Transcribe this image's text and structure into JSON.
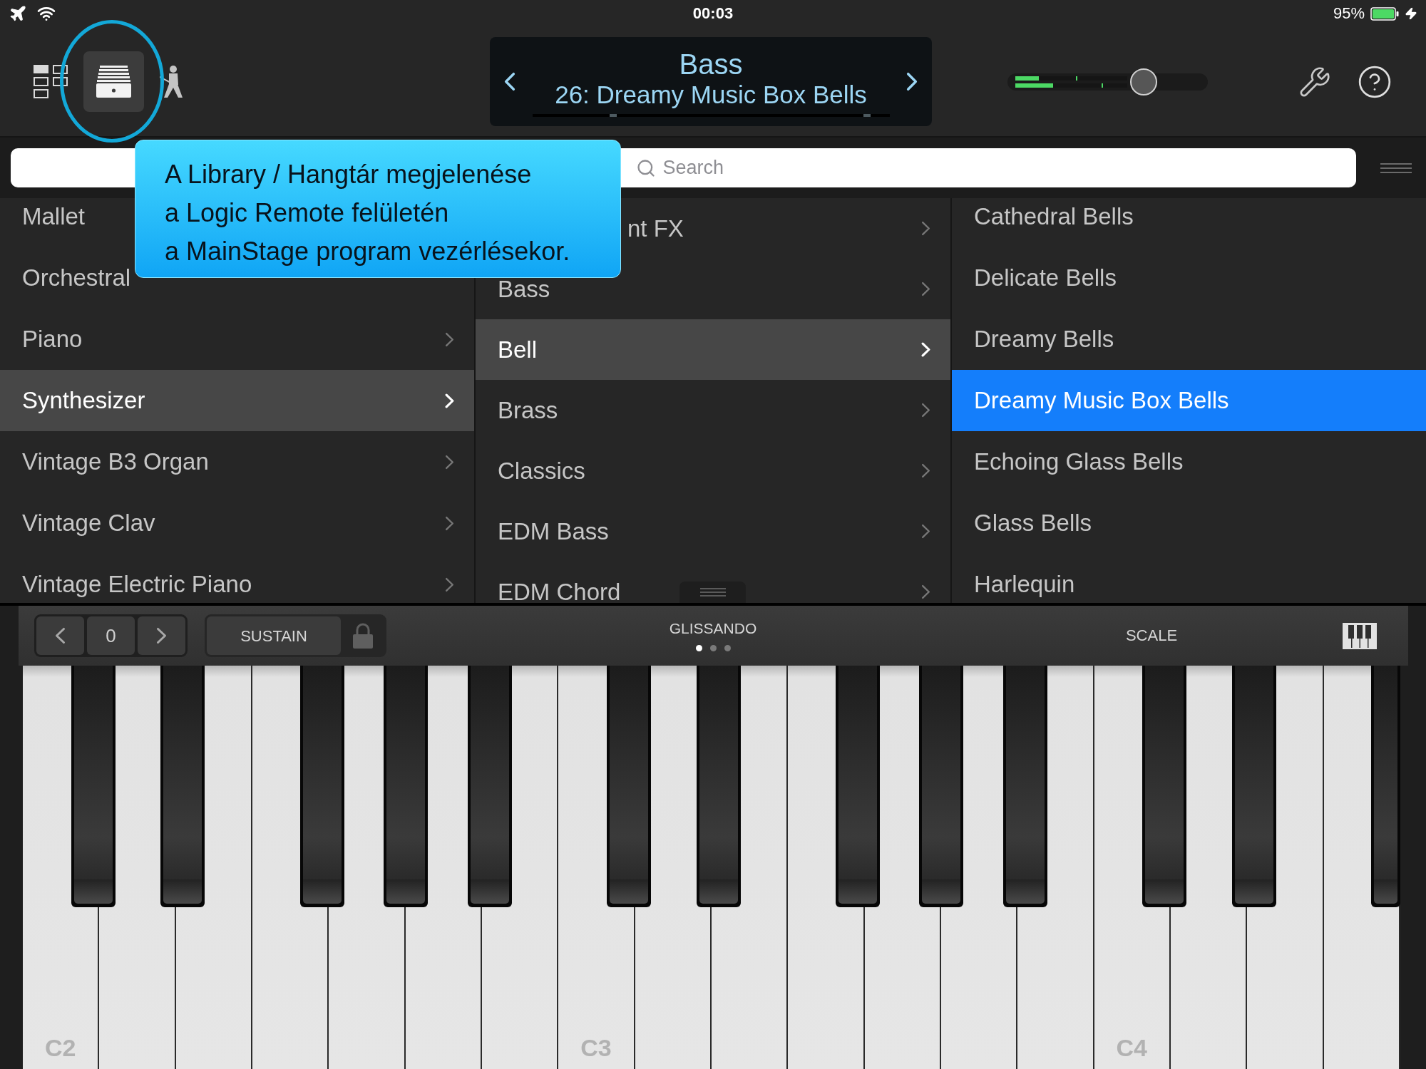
{
  "status_bar": {
    "time": "00:03",
    "battery": "95%"
  },
  "toolbar": {
    "views": [
      {
        "kind": "layout",
        "selected": false
      },
      {
        "kind": "library",
        "selected": true
      },
      {
        "kind": "performer",
        "selected": false
      }
    ],
    "patch": {
      "category": "Bass",
      "name": "26: Dreamy Music Box Bells"
    },
    "volume": {
      "level": 0.68,
      "meters": [
        {
          "level": 0.21
        },
        {
          "level": 0.34
        }
      ],
      "peaks": [
        {
          "level": 0.54
        },
        {
          "level": 0.77
        }
      ]
    }
  },
  "search": {
    "placeholder": "Search"
  },
  "library": {
    "columns": [
      {
        "kind": "category",
        "items": [
          {
            "label": "Mallet",
            "selected": false,
            "chevron": false
          },
          {
            "label": "Orchestral",
            "selected": false,
            "chevron": false
          },
          {
            "label": "Piano",
            "selected": false,
            "chevron": true
          },
          {
            "label": "Synthesizer",
            "selected": true,
            "chevron": true
          },
          {
            "label": "Vintage B3 Organ",
            "selected": false,
            "chevron": true
          },
          {
            "label": "Vintage Clav",
            "selected": false,
            "chevron": true
          },
          {
            "label": "Vintage Electric Piano",
            "selected": false,
            "chevron": true
          }
        ]
      },
      {
        "kind": "category",
        "items": [
          {
            "label": "nt FX",
            "selected": false,
            "chevron": true
          },
          {
            "label": "Bass",
            "selected": false,
            "chevron": true
          },
          {
            "label": "Bell",
            "selected": true,
            "chevron": true
          },
          {
            "label": "Brass",
            "selected": false,
            "chevron": true
          },
          {
            "label": "Classics",
            "selected": false,
            "chevron": true
          },
          {
            "label": "EDM Bass",
            "selected": false,
            "chevron": true
          },
          {
            "label": "EDM Chord",
            "selected": false,
            "chevron": true
          }
        ]
      },
      {
        "kind": "patch",
        "items": [
          {
            "label": "Cathedral Bells",
            "selected": false
          },
          {
            "label": "Delicate Bells",
            "selected": false
          },
          {
            "label": "Dreamy Bells",
            "selected": false
          },
          {
            "label": "Dreamy Music Box Bells",
            "selected": true
          },
          {
            "label": "Echoing Glass Bells",
            "selected": false
          },
          {
            "label": "Glass Bells",
            "selected": false
          },
          {
            "label": "Harlequin",
            "selected": false
          }
        ]
      }
    ]
  },
  "callout": {
    "lines": [
      "A Library / Hangtár megjelenése",
      "a Logic Remote felületén",
      "a MainStage program vezérlésekor."
    ]
  },
  "keyboard_toolbar": {
    "octave": "0",
    "sustain": "SUSTAIN",
    "mode": {
      "label": "GLISSANDO",
      "pages": [
        {
          "selected": true
        },
        {
          "selected": false
        },
        {
          "selected": false
        }
      ]
    },
    "scale": "SCALE"
  },
  "keyboard": {
    "octave_labels": [
      "C2",
      "C3",
      "C4"
    ]
  }
}
